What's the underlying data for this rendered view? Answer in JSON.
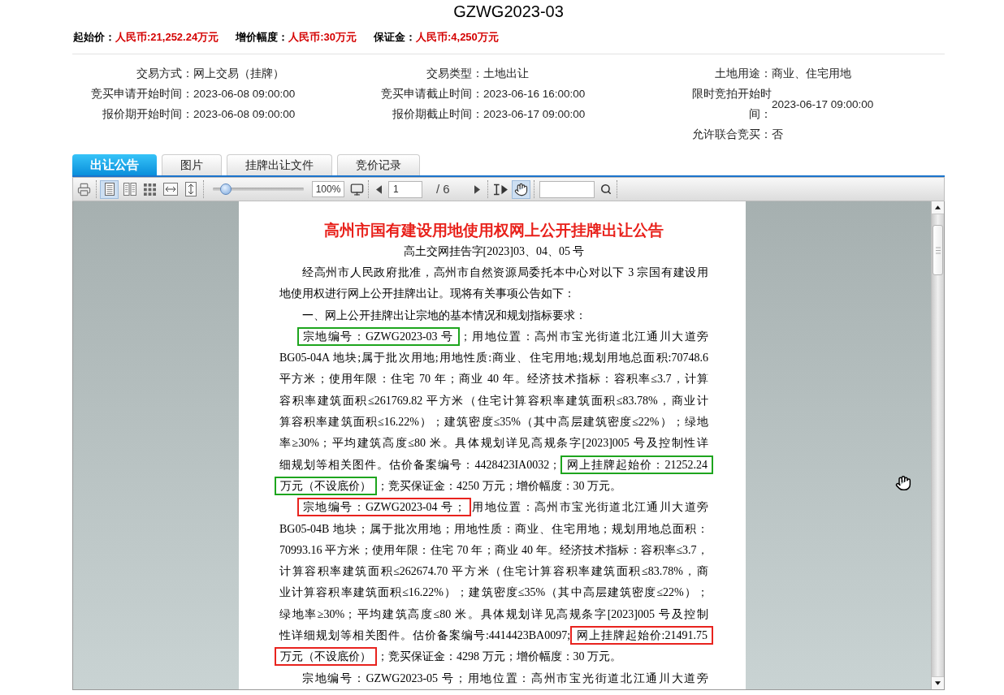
{
  "title": "GZWG2023-03",
  "prices": [
    {
      "label": "起始价：",
      "value": "人民币:21,252.24万元"
    },
    {
      "label": "增价幅度：",
      "value": "人民币:30万元"
    },
    {
      "label": "保证金：",
      "value": "人民币:4,250万元"
    }
  ],
  "info_columns": [
    [
      {
        "label": "交易方式：",
        "value": "网上交易（挂牌）"
      },
      {
        "label": "竞买申请开始时间：",
        "value": "2023-06-08 09:00:00"
      },
      {
        "label": "报价期开始时间：",
        "value": "2023-06-08 09:00:00"
      }
    ],
    [
      {
        "label": "交易类型：",
        "value": "土地出让"
      },
      {
        "label": "竞买申请截止时间：",
        "value": "2023-06-16 16:00:00"
      },
      {
        "label": "报价期截止时间：",
        "value": "2023-06-17 09:00:00"
      }
    ],
    [
      {
        "label": "土地用途：",
        "value": "商业、住宅用地"
      },
      {
        "label": "限时竞拍开始时间：",
        "value": "2023-06-17 09:00:00"
      },
      {
        "label": "允许联合竞买：",
        "value": "否"
      }
    ]
  ],
  "tabs": [
    {
      "label": "出让公告",
      "selected": true
    },
    {
      "label": "图片",
      "selected": false
    },
    {
      "label": "挂牌出让文件",
      "selected": false
    },
    {
      "label": "竞价记录",
      "selected": false
    }
  ],
  "toolbar": {
    "view_buttons": [
      {
        "selected": true
      },
      {
        "selected": false
      },
      {
        "selected": false
      },
      {
        "selected": false
      },
      {
        "selected": false
      }
    ],
    "zoom": {
      "level": 0.14,
      "value": "100%"
    },
    "page": {
      "value": "1",
      "total": "/ 6"
    },
    "tool_buttons": [
      {
        "selected": false
      },
      {
        "selected": true
      }
    ]
  },
  "document": {
    "title": "高州市国有建设用地使用权网上公开挂牌出让公告",
    "subtitle": "高土交网挂告字[2023]03、04、05 号",
    "paragraphs": [
      {
        "lines": [
          {
            "segments": [
              {
                "kind": "plain",
                "text": "经高州市人民政府批准，高州市自然资源局委托本中心对以下 3 宗国有建设用"
              }
            ]
          },
          {
            "segments": [
              {
                "kind": "plain",
                "text": "地使用权进行网上公开挂牌出让。现将有关事项公告如下："
              }
            ]
          }
        ]
      },
      {
        "lines": [
          {
            "segments": [
              {
                "kind": "plain",
                "text": "一、网上公开挂牌出让宗地的基本情况和规划指标要求："
              }
            ]
          }
        ]
      },
      {
        "lines": [
          {
            "segments": [
              {
                "kind": "framed",
                "color": "#1ea51e",
                "text": "宗地编号：GZWG2023-03 号"
              },
              {
                "kind": "plain",
                "text": "；用地位置：高州市宝光街道北江通川大道旁"
              }
            ]
          },
          {
            "segments": [
              {
                "kind": "plain",
                "text": "BG05-04A 地块;属于批次用地;用地性质:商业、住宅用地;规划用地总面积:70748.6"
              }
            ]
          },
          {
            "segments": [
              {
                "kind": "plain",
                "text": "平方米；使用年限：住宅 70 年；商业 40 年。经济技术指标：容积率≤3.7，计算"
              }
            ]
          },
          {
            "segments": [
              {
                "kind": "plain",
                "text": "容积率建筑面积≤261769.82 平方米（住宅计算容积率建筑面积≤83.78%，商业计"
              }
            ]
          },
          {
            "segments": [
              {
                "kind": "plain",
                "text": "算容积率建筑面积≤16.22%）；建筑密度≤35%（其中高层建筑密度≤22%）；绿地"
              }
            ]
          },
          {
            "segments": [
              {
                "kind": "plain",
                "text": "率≥30%；平均建筑高度≤80 米。具体规划详见高规条字[2023]005 号及控制性详"
              }
            ]
          },
          {
            "segments": [
              {
                "kind": "plain",
                "text": "细规划等相关图件。估价备案编号：4428423IA0032；"
              },
              {
                "kind": "framed",
                "color": "#1ea51e",
                "text": "网上挂牌起始价：21252.24"
              }
            ]
          },
          {
            "segments": [
              {
                "kind": "framed",
                "color": "#1ea51e",
                "text": "万元（不设底价）"
              },
              {
                "kind": "plain",
                "text": "；竞买保证金：4250 万元；增价幅度：30 万元。"
              }
            ]
          }
        ]
      },
      {
        "lines": [
          {
            "segments": [
              {
                "kind": "framed",
                "color": "#e8231e",
                "text": "宗地编号：GZWG2023-04 号；"
              },
              {
                "kind": "plain",
                "text": "用地位置：高州市宝光街道北江通川大道旁"
              }
            ]
          },
          {
            "segments": [
              {
                "kind": "plain",
                "text": "BG05-04B 地块；属于批次用地；用地性质：商业、住宅用地；规划用地总面积："
              }
            ]
          },
          {
            "segments": [
              {
                "kind": "plain",
                "text": "70993.16 平方米；使用年限：住宅 70 年；商业 40 年。经济技术指标：容积率≤3.7，"
              }
            ]
          },
          {
            "segments": [
              {
                "kind": "plain",
                "text": "计算容积率建筑面积≤262674.70 平方米（住宅计算容积率建筑面积≤83.78%，商"
              }
            ]
          },
          {
            "segments": [
              {
                "kind": "plain",
                "text": "业计算容积率建筑面积≤16.22%）；建筑密度≤35%（其中高层建筑密度≤22%）；"
              }
            ]
          },
          {
            "segments": [
              {
                "kind": "plain",
                "text": "绿地率≥30%；平均建筑高度≤80 米。具体规划详见高规条字[2023]005 号及控制"
              }
            ]
          },
          {
            "segments": [
              {
                "kind": "plain",
                "text": "性详细规划等相关图件。估价备案编号:4414423BA0097;"
              },
              {
                "kind": "framed",
                "color": "#e8231e",
                "text": "网上挂牌起始价:21491.75"
              }
            ]
          },
          {
            "segments": [
              {
                "kind": "framed",
                "color": "#e8231e",
                "text": "万元（不设底价）"
              },
              {
                "kind": "plain",
                "text": "；竞买保证金：4298 万元；增价幅度：30 万元。"
              }
            ]
          }
        ]
      },
      {
        "lines": [
          {
            "segments": [
              {
                "kind": "plain",
                "text": "宗地编号：GZWG2023-05 号；用地位置：高州市宝光街道北江通川大道旁"
              }
            ]
          }
        ]
      }
    ]
  }
}
